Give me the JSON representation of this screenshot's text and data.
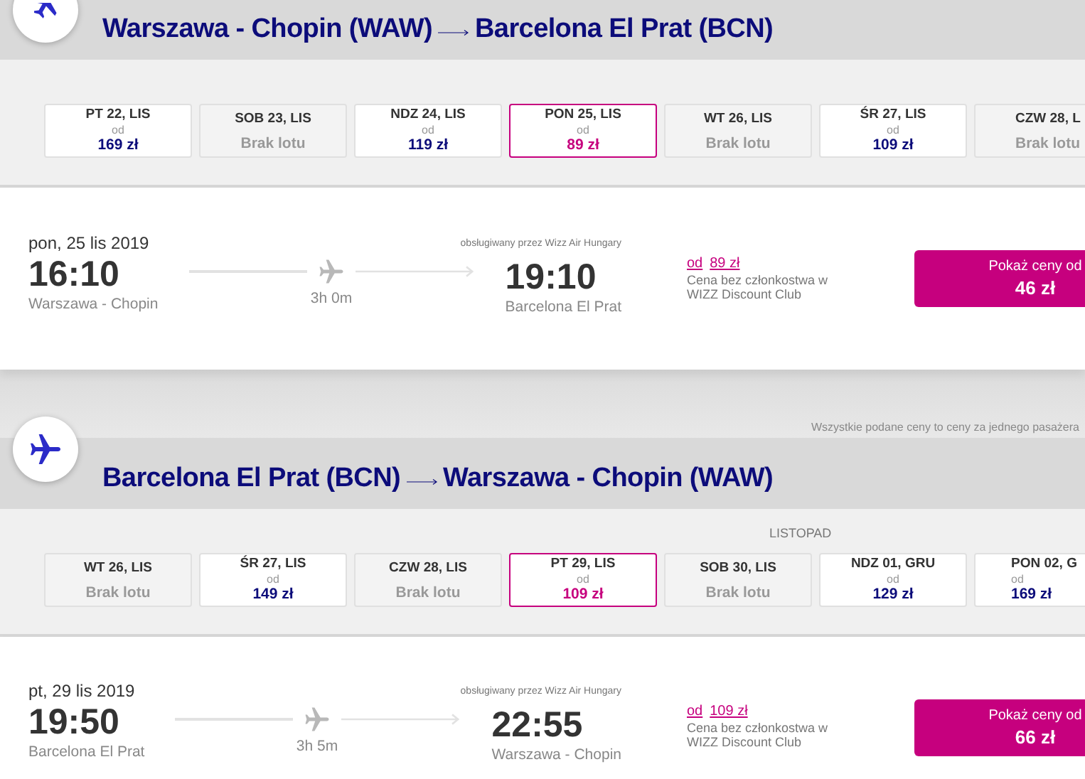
{
  "legs": [
    {
      "route": {
        "from": "Warszawa - Chopin (WAW)",
        "to": "Barcelona El Prat (BCN)"
      },
      "days": [
        {
          "kind": "price",
          "day": "PT 22, LIS",
          "from_label": "od",
          "price": "169 zł",
          "selected": false
        },
        {
          "kind": "none",
          "day": "SOB 23, LIS",
          "status": "Brak lotu",
          "selected": false
        },
        {
          "kind": "price",
          "day": "NDZ 24, LIS",
          "from_label": "od",
          "price": "119 zł",
          "selected": false
        },
        {
          "kind": "price",
          "day": "PON 25, LIS",
          "from_label": "od",
          "price": "89 zł",
          "selected": true
        },
        {
          "kind": "none",
          "day": "WT 26, LIS",
          "status": "Brak lotu",
          "selected": false
        },
        {
          "kind": "price",
          "day": "ŚR 27, LIS",
          "from_label": "od",
          "price": "109 zł",
          "selected": false
        },
        {
          "kind": "none",
          "day": "CZW 28, L",
          "status": "Brak lotu",
          "selected": false
        }
      ],
      "flight": {
        "date": "pon, 25 lis 2019",
        "departure_time": "16:10",
        "departure_airport": "Warszawa - Chopin",
        "duration": "3h 0m",
        "operator": "obsługiwany przez Wizz Air Hungary",
        "arrival_time": "19:10",
        "arrival_airport": "Barcelona El Prat",
        "price_from_label": "od",
        "price_from": "89 zł",
        "price_note": "Cena bez członkostwa w WIZZ Discount Club",
        "button_label": "Pokaż ceny od",
        "button_price": "46 zł"
      },
      "note": "Wszystkie podane ceny to ceny za jednego pasażera"
    },
    {
      "route": {
        "from": "Barcelona El Prat (BCN)",
        "to": "Warszawa - Chopin (WAW)"
      },
      "month_label": "LISTOPAD",
      "days": [
        {
          "kind": "none",
          "day": "WT 26, LIS",
          "status": "Brak lotu",
          "selected": false
        },
        {
          "kind": "price",
          "day": "ŚR 27, LIS",
          "from_label": "od",
          "price": "149 zł",
          "selected": false
        },
        {
          "kind": "none",
          "day": "CZW 28, LIS",
          "status": "Brak lotu",
          "selected": false
        },
        {
          "kind": "price",
          "day": "PT 29, LIS",
          "from_label": "od",
          "price": "109 zł",
          "selected": true
        },
        {
          "kind": "none",
          "day": "SOB 30, LIS",
          "status": "Brak lotu",
          "selected": false
        },
        {
          "kind": "price",
          "day": "NDZ 01, GRU",
          "from_label": "od",
          "price": "129 zł",
          "selected": false
        },
        {
          "kind": "price",
          "day": "PON 02, G",
          "from_label": "od",
          "price": "169 zł",
          "selected": false
        }
      ],
      "flight": {
        "date": "pt, 29 lis 2019",
        "departure_time": "19:50",
        "departure_airport": "Barcelona El Prat",
        "duration": "3h 5m",
        "operator": "obsługiwany przez Wizz Air Hungary",
        "arrival_time": "22:55",
        "arrival_airport": "Warszawa - Chopin",
        "price_from_label": "od",
        "price_from": "109 zł",
        "price_note": "Cena bez członkostwa w WIZZ Discount Club",
        "button_label": "Pokaż ceny od",
        "button_price": "66 zł"
      }
    }
  ]
}
